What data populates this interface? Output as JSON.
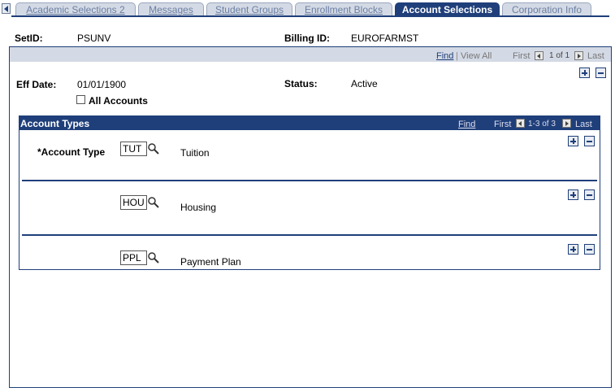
{
  "tabs": [
    {
      "label": "Academic Selections 2",
      "active": false
    },
    {
      "label": "Messages",
      "active": false
    },
    {
      "label": "Student Groups",
      "active": false
    },
    {
      "label": "Enrollment Blocks",
      "active": false
    },
    {
      "label": "Account Selections",
      "active": true
    },
    {
      "label": "Corporation Info",
      "active": false
    }
  ],
  "header": {
    "setid_label": "SetID:",
    "setid_value": "PSUNV",
    "billing_label": "Billing ID:",
    "billing_value": "EUROFARMST"
  },
  "main_nav": {
    "find": "Find",
    "sep": "|",
    "view_all": "View All",
    "first": "First",
    "count": "1 of 1",
    "last": "Last"
  },
  "effective": {
    "eff_label": "Eff Date:",
    "eff_value": "01/01/1900",
    "status_label": "Status:",
    "status_value": "Active",
    "all_accounts_label": "All Accounts",
    "all_accounts_checked": false
  },
  "account_types": {
    "title": "Account Types",
    "find": "Find",
    "first": "First",
    "count": "1-3 of 3",
    "last": "Last",
    "field_label": "*Account Type",
    "rows": [
      {
        "code": "TUT",
        "description": "Tuition"
      },
      {
        "code": "HOU",
        "description": "Housing"
      },
      {
        "code": "PPL",
        "description": "Payment Plan"
      }
    ]
  },
  "colors": {
    "accent": "#1f3f7a",
    "header_bg": "#d4dae5"
  }
}
